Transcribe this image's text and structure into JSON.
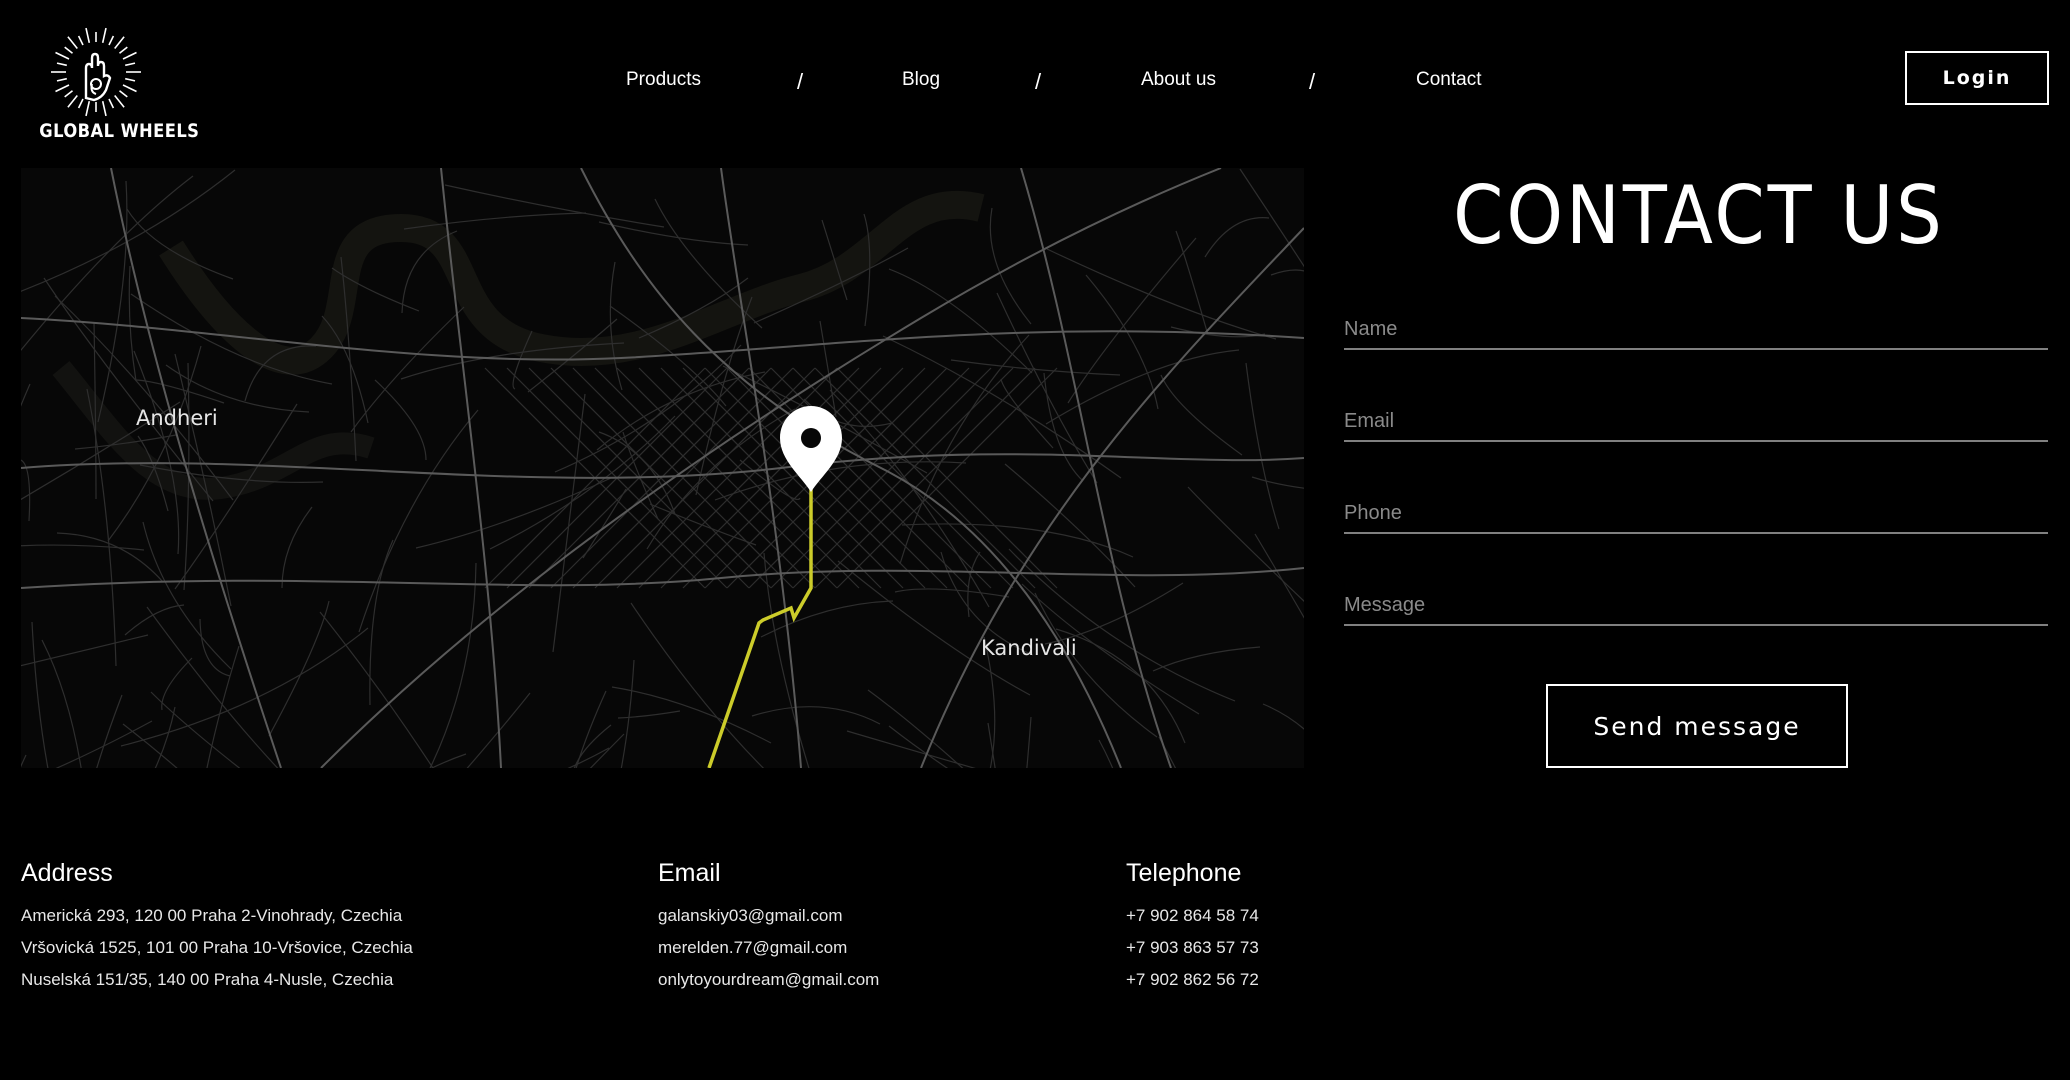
{
  "brand": {
    "name": "GLOBAL WHEELS",
    "logo_icon": "hand-sunburst-icon"
  },
  "nav": {
    "items": [
      "Products",
      "Blog",
      "About us",
      "Contact"
    ],
    "separator": "/"
  },
  "header": {
    "login_label": "Login"
  },
  "map": {
    "labels": {
      "west": "Andheri",
      "east": "Kandivali"
    },
    "pin_icon": "location-pin-icon",
    "route_color": "#cccc2a"
  },
  "contact": {
    "title": "CONTACT US",
    "fields": {
      "name_placeholder": "Name",
      "email_placeholder": "Email",
      "phone_placeholder": "Phone",
      "message_placeholder": "Message"
    },
    "send_label": "Send message"
  },
  "info": {
    "address": {
      "heading": "Address",
      "lines": [
        "Americká 293, 120 00 Praha 2-Vinohrady, Czechia",
        "Vršovická 1525, 101 00 Praha 10-Vršovice, Czechia",
        "Nuselská 151/35, 140 00 Praha 4-Nusle, Czechia"
      ]
    },
    "email": {
      "heading": "Email",
      "lines": [
        "galanskiy03@gmail.com",
        "merelden.77@gmail.com",
        "onlytoyourdream@gmail.com"
      ]
    },
    "telephone": {
      "heading": "Telephone",
      "lines": [
        "+7 902 864 58 74",
        "+7 903 863 57 73",
        "+7 902 862 56 72"
      ]
    }
  }
}
